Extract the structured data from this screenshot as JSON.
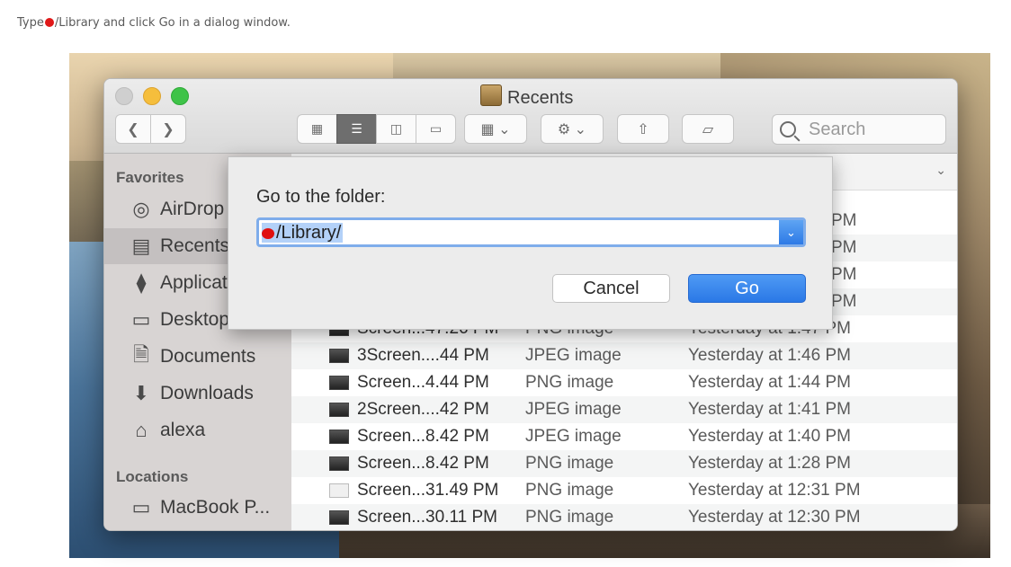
{
  "caption": {
    "prefix": "Type",
    "suffix": "/Library and click Go in a dialog window."
  },
  "window": {
    "title": "Recents"
  },
  "toolbar": {
    "search_placeholder": "Search"
  },
  "sidebar": {
    "favorites_header": "Favorites",
    "locations_header": "Locations",
    "items": [
      {
        "label": "AirDrop",
        "icon": "airdrop-icon"
      },
      {
        "label": "Recents",
        "icon": "recents-icon",
        "selected": true
      },
      {
        "label": "Applicat",
        "icon": "applications-icon"
      },
      {
        "label": "Desktop",
        "icon": "desktop-icon"
      },
      {
        "label": "Documents",
        "icon": "documents-icon"
      },
      {
        "label": "Downloads",
        "icon": "downloads-icon"
      },
      {
        "label": "alexa",
        "icon": "home-icon"
      }
    ],
    "locations": [
      {
        "label": "MacBook P...",
        "icon": "laptop-icon"
      }
    ]
  },
  "files": [
    {
      "name": "",
      "kind": "",
      "date": "PM"
    },
    {
      "name": "",
      "kind": "",
      "date": "PM"
    },
    {
      "name": "",
      "kind": "",
      "date": "PM"
    },
    {
      "name": "",
      "kind": "",
      "date": "PM"
    },
    {
      "name": "Screen...47.26 PM",
      "kind": "PNG image",
      "date": "Yesterday at 1:47 PM"
    },
    {
      "name": "3Screen....44 PM",
      "kind": "JPEG image",
      "date": "Yesterday at 1:46 PM"
    },
    {
      "name": "Screen...4.44 PM",
      "kind": "PNG image",
      "date": "Yesterday at 1:44 PM"
    },
    {
      "name": "2Screen....42 PM",
      "kind": "JPEG image",
      "date": "Yesterday at 1:41 PM"
    },
    {
      "name": "Screen...8.42 PM",
      "kind": "JPEG image",
      "date": "Yesterday at 1:40 PM"
    },
    {
      "name": "Screen...8.42 PM",
      "kind": "PNG image",
      "date": "Yesterday at 1:28 PM"
    },
    {
      "name": "Screen...31.49 PM",
      "kind": "PNG image",
      "date": "Yesterday at 12:31 PM"
    },
    {
      "name": "Screen...30.11 PM",
      "kind": "PNG image",
      "date": "Yesterday at 12:30 PM"
    }
  ],
  "dialog": {
    "prompt": "Go to the folder:",
    "field_value": "/Library/",
    "cancel_label": "Cancel",
    "go_label": "Go"
  }
}
